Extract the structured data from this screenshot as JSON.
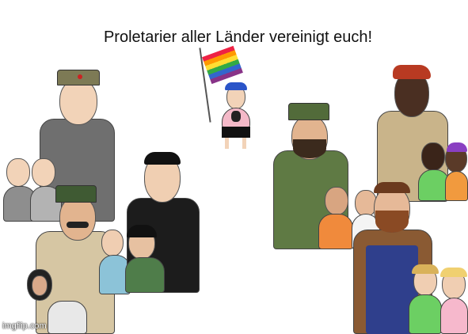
{
  "title": "Proletarier aller Länder vereinigt euch!",
  "watermark": "imgflip.com",
  "colors": {
    "background": "#ffffff",
    "text": "#111111"
  }
}
